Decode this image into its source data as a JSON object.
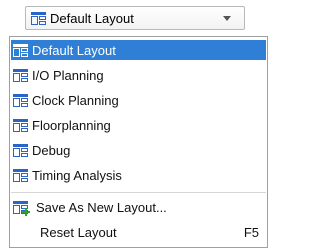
{
  "combo": {
    "value": "Default Layout",
    "icon": "layout-icon",
    "arrow_icon": "chevron-down-icon"
  },
  "menu": {
    "items": [
      {
        "label": "Default Layout",
        "icon": "layout-icon",
        "selected": true
      },
      {
        "label": "I/O Planning",
        "icon": "layout-icon"
      },
      {
        "label": "Clock Planning",
        "icon": "layout-icon"
      },
      {
        "label": "Floorplanning",
        "icon": "layout-icon"
      },
      {
        "label": "Debug",
        "icon": "layout-icon"
      },
      {
        "label": "Timing Analysis",
        "icon": "layout-icon"
      }
    ],
    "actions": {
      "save_label": "Save As New Layout...",
      "save_icon": "save-layout-icon",
      "reset_label": "Reset Layout",
      "reset_shortcut": "F5"
    }
  },
  "colors": {
    "selection": "#2f7fd6",
    "icon": "#2b63c8",
    "plus": "#2ba12b"
  }
}
